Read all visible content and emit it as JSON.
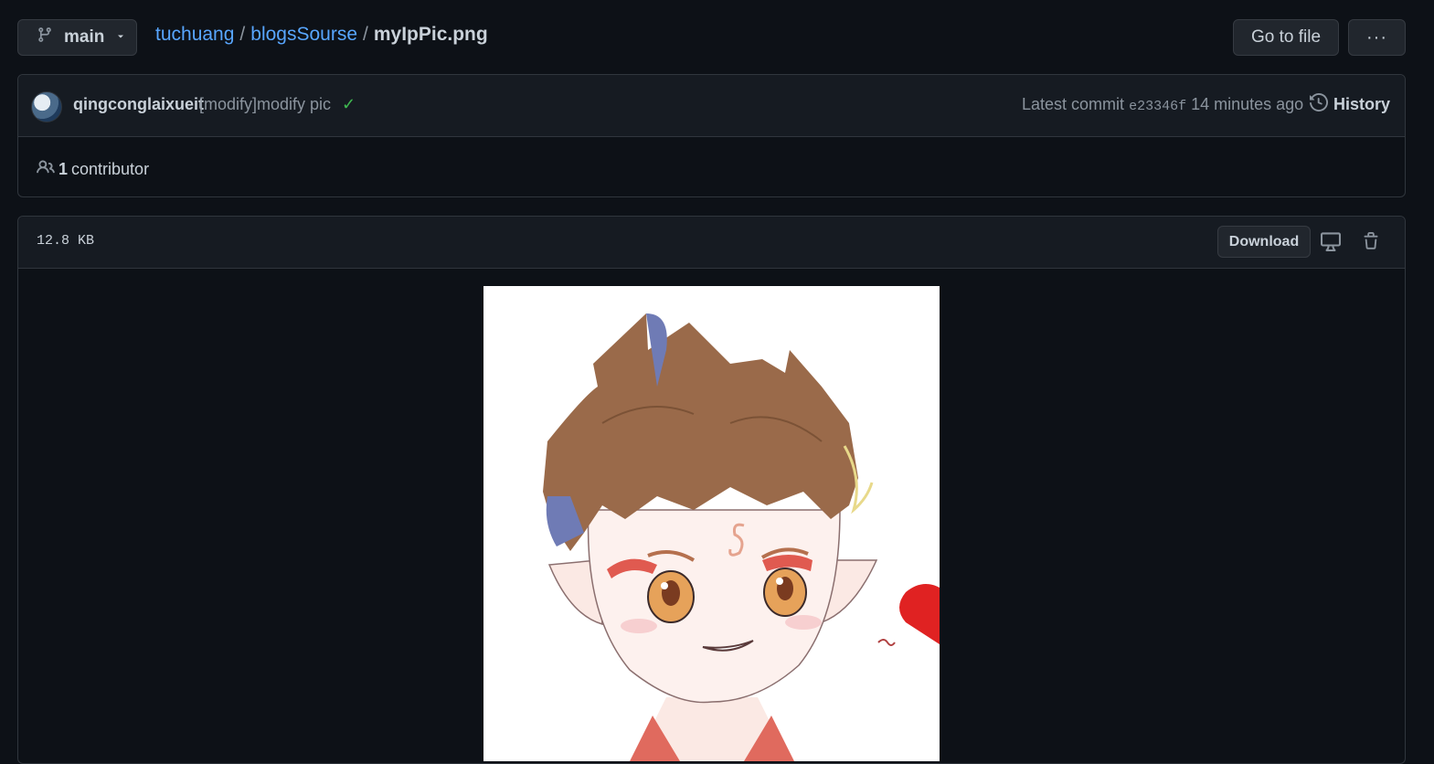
{
  "branch": {
    "label": "main"
  },
  "breadcrumb": {
    "owner": "tuchuang",
    "separator": "/",
    "repo": "blogsSourse",
    "file": "myIpPic.png"
  },
  "toolbar": {
    "go_to_file": "Go to file",
    "more": "···"
  },
  "commit": {
    "author": "qingconglaixueit",
    "message": "[modify]modify pic",
    "status": "✓",
    "latest_label": "Latest commit",
    "sha": "e23346f",
    "time": "14 minutes ago",
    "history_label": "History"
  },
  "contributors": {
    "count": "1",
    "label": "contributor"
  },
  "file": {
    "size": "12.8 KB",
    "download_label": "Download"
  },
  "colors": {
    "background": "#0d1117",
    "panel": "#161b22",
    "border": "#30363d",
    "link": "#58a6ff",
    "success": "#3fb950"
  },
  "icons": [
    "git-branch-icon",
    "caret-down-icon",
    "kebab-horizontal-icon",
    "check-icon",
    "history-icon",
    "people-icon",
    "desktop-icon",
    "trash-icon"
  ]
}
